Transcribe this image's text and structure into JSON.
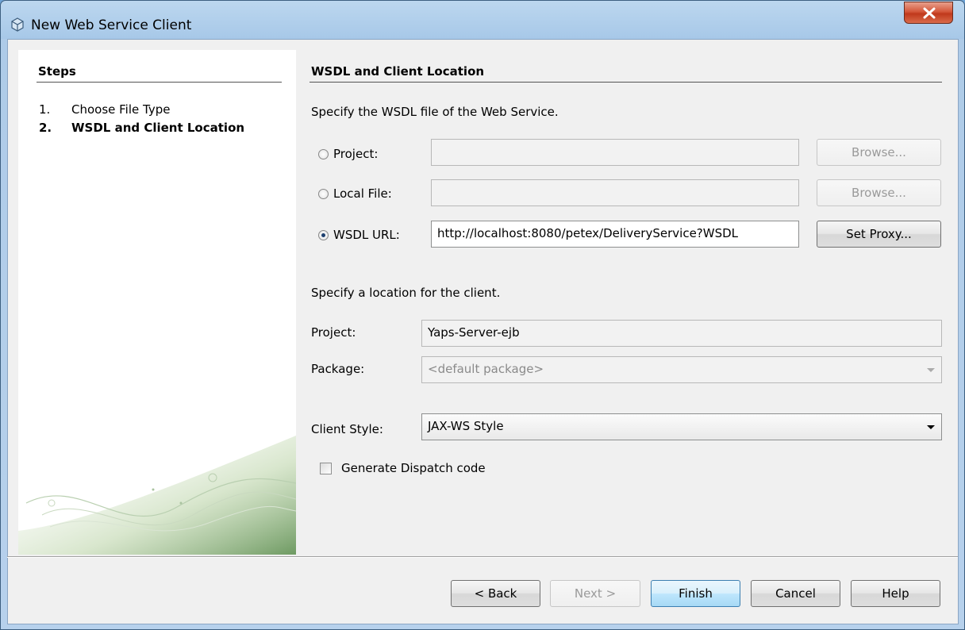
{
  "window": {
    "title": "New Web Service Client",
    "close_label": "X"
  },
  "steps": {
    "title": "Steps",
    "items": [
      {
        "num": "1.",
        "label": "Choose File Type"
      },
      {
        "num": "2.",
        "label": "WSDL and Client Location"
      }
    ]
  },
  "panel": {
    "title": "WSDL and Client Location",
    "wsdl_instruction": "Specify the WSDL file of the Web Service.",
    "project_radio": {
      "label": "Project:",
      "value": "",
      "browse": "Browse..."
    },
    "local_file_radio": {
      "label": "Local File:",
      "value": "",
      "browse": "Browse..."
    },
    "wsdl_url_radio": {
      "label": "WSDL URL:",
      "value": "http://localhost:8080/petex/DeliveryService?WSDL",
      "proxy": "Set Proxy..."
    },
    "location_instruction": "Specify a location for the client.",
    "project": {
      "label": "Project:",
      "value": "Yaps-Server-ejb"
    },
    "package": {
      "label": "Package:",
      "value": "<default package>"
    },
    "client_style": {
      "label": "Client Style:",
      "value": "JAX-WS Style"
    },
    "dispatch": {
      "label": "Generate Dispatch code",
      "checked": false
    }
  },
  "footer": {
    "back": "< Back",
    "next": "Next >",
    "finish": "Finish",
    "cancel": "Cancel",
    "help": "Help"
  }
}
